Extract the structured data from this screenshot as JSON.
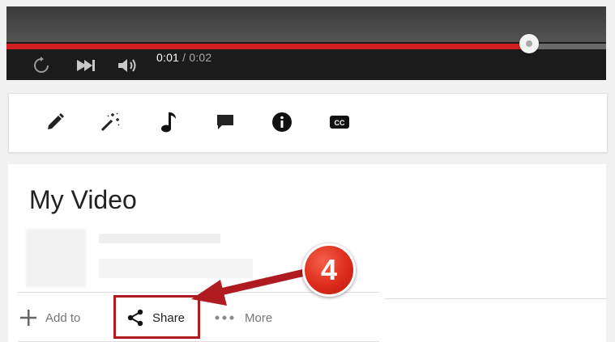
{
  "player": {
    "progress_fraction": 0.872,
    "current_time": "0:01",
    "time_separator": "/",
    "duration": "0:02",
    "icons": [
      "replay-icon",
      "next-icon",
      "volume-icon"
    ],
    "colors": {
      "played": "#d21f1f",
      "track": "#6a6a6a",
      "bar": "#1b1b1b"
    }
  },
  "edit_toolbar": {
    "tools": [
      {
        "name": "enhance-pencil-icon"
      },
      {
        "name": "magic-wand-icon"
      },
      {
        "name": "audio-note-icon"
      },
      {
        "name": "annotations-icon"
      },
      {
        "name": "info-icon"
      },
      {
        "name": "subtitles-cc-icon",
        "text": "CC"
      }
    ]
  },
  "video": {
    "title": "My Video"
  },
  "actions": {
    "add_to": "Add to",
    "share": "Share",
    "more": "More"
  },
  "annotation": {
    "step_number": "4",
    "color": "#b01b22"
  }
}
